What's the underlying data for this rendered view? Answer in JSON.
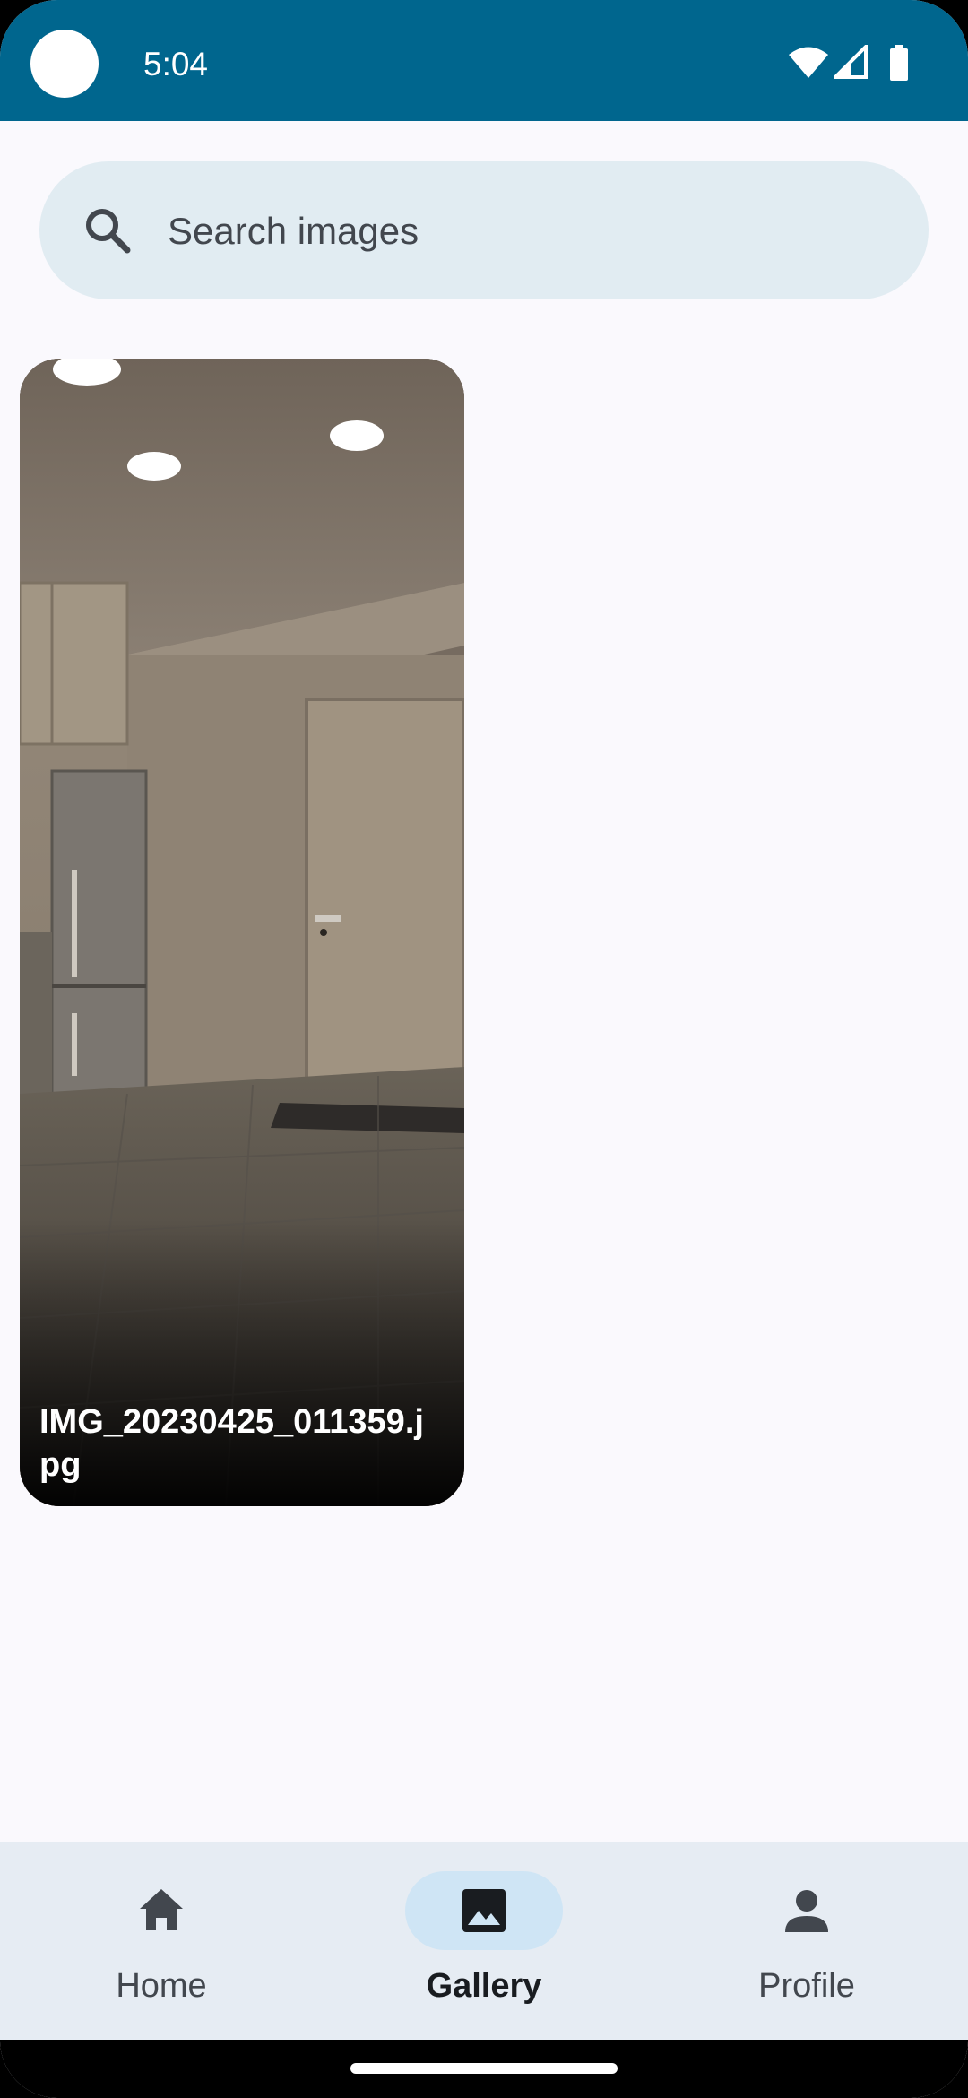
{
  "status_bar": {
    "time": "5:04",
    "icons": [
      "wifi-icon",
      "cellular-signal-icon",
      "battery-icon"
    ]
  },
  "search": {
    "placeholder": "Search images",
    "value": ""
  },
  "gallery": {
    "images": [
      {
        "filename": "IMG_20230425_011359.jpg"
      }
    ]
  },
  "bottom_nav": {
    "items": [
      {
        "label": "Home",
        "icon": "home-icon",
        "active": false
      },
      {
        "label": "Gallery",
        "icon": "image-icon",
        "active": true
      },
      {
        "label": "Profile",
        "icon": "person-icon",
        "active": false
      }
    ]
  },
  "colors": {
    "status_bar": "#00668e",
    "background": "#faf9fd",
    "search_bar": "#e1ecf2",
    "nav_bar": "#e6ecf3",
    "nav_active_pill": "#cfe5f5"
  }
}
